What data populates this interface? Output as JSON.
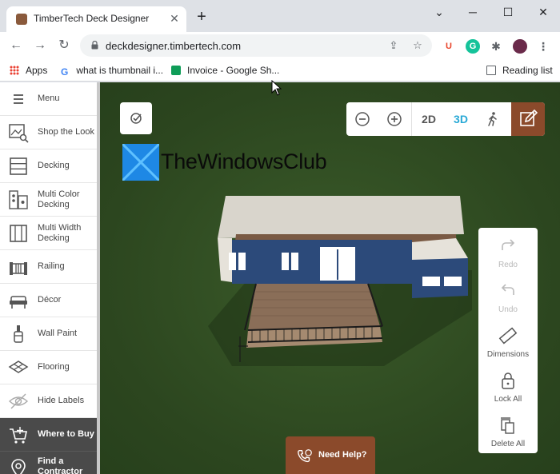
{
  "browser": {
    "tab_title": "TimberTech Deck Designer",
    "url": "deckdesigner.timbertech.com",
    "bookmarks": [
      {
        "label": "Apps"
      },
      {
        "label": "what is thumbnail i..."
      },
      {
        "label": "Invoice - Google Sh..."
      }
    ],
    "reading_list": "Reading list",
    "extension_u": "U",
    "extension_g": "G"
  },
  "sidebar": {
    "items": [
      {
        "label": "Menu",
        "icon": "hamburger-icon"
      },
      {
        "label": "Shop the Look",
        "icon": "shop-the-look-icon"
      },
      {
        "label": "Decking",
        "icon": "decking-icon"
      },
      {
        "label": "Multi Color Decking",
        "icon": "multi-color-decking-icon"
      },
      {
        "label": "Multi Width Decking",
        "icon": "multi-width-decking-icon"
      },
      {
        "label": "Railing",
        "icon": "railing-icon"
      },
      {
        "label": "Décor",
        "icon": "decor-icon"
      },
      {
        "label": "Wall Paint",
        "icon": "wall-paint-icon"
      },
      {
        "label": "Flooring",
        "icon": "flooring-icon"
      },
      {
        "label": "Hide Labels",
        "icon": "eye-icon"
      },
      {
        "label": "Where to Buy",
        "icon": "cart-icon"
      },
      {
        "label": "Find a Contractor",
        "icon": "location-pin-icon"
      }
    ]
  },
  "view_toolbar": {
    "zoom_out": "zoom-out-icon",
    "zoom_in": "zoom-in-icon",
    "mode_2d": "2D",
    "mode_3d": "3D",
    "active_mode": "3D",
    "active_color": "#29a9d6",
    "walk": "walk-icon",
    "edit": "edit-icon"
  },
  "watermark": {
    "text": "TheWindowsClub"
  },
  "right_panel": {
    "items": [
      {
        "label": "Redo",
        "icon": "redo-icon",
        "enabled": false
      },
      {
        "label": "Undo",
        "icon": "undo-icon",
        "enabled": false
      },
      {
        "label": "Dimensions",
        "icon": "ruler-icon",
        "enabled": true
      },
      {
        "label": "Lock All",
        "icon": "lock-icon",
        "enabled": true
      },
      {
        "label": "Delete All",
        "icon": "delete-all-icon",
        "enabled": true
      }
    ]
  },
  "help": {
    "label": "Need Help?"
  },
  "colors": {
    "brand_brown": "#8b4a2b",
    "grass": "#2e4a22",
    "house_blue": "#2c4a7a"
  }
}
